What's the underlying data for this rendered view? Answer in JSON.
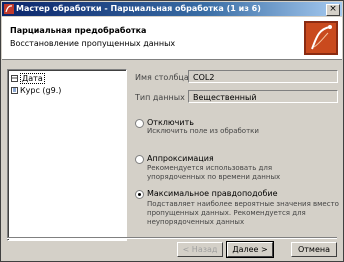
{
  "window": {
    "title": "Мастер обработки - Парциальная обработка  (1 из 6)",
    "close_glyph": "×"
  },
  "header": {
    "title": "Парциальная предобработка",
    "subtitle": "Восстановление пропущенных данных"
  },
  "tree": {
    "items": [
      {
        "label": "Дата",
        "icon": "table-column-icon"
      },
      {
        "label": "Курс (g9.)",
        "icon": "numeric-column-icon"
      }
    ]
  },
  "column_info": {
    "name_label": "Имя столбца",
    "name_value": "COL2",
    "type_label": "Тип данных",
    "type_value": "Вещественный"
  },
  "options": [
    {
      "label": "Отключить",
      "description": [
        "Исключить поле из обработки"
      ],
      "selected": false
    },
    {
      "label": "Аппроксимация",
      "description": [
        "Рекомендуется использовать для",
        "упорядоченных по времени данных"
      ],
      "selected": false
    },
    {
      "label": "Максимальное правдоподобие",
      "description": [
        "Подставляет наиболее вероятные значения вместо",
        "пропущенных данных. Рекомендуется для",
        "неупорядоченных данных"
      ],
      "selected": true
    }
  ],
  "buttons": {
    "back": "< Назад",
    "next": "Далее >",
    "cancel": "Отмена"
  }
}
